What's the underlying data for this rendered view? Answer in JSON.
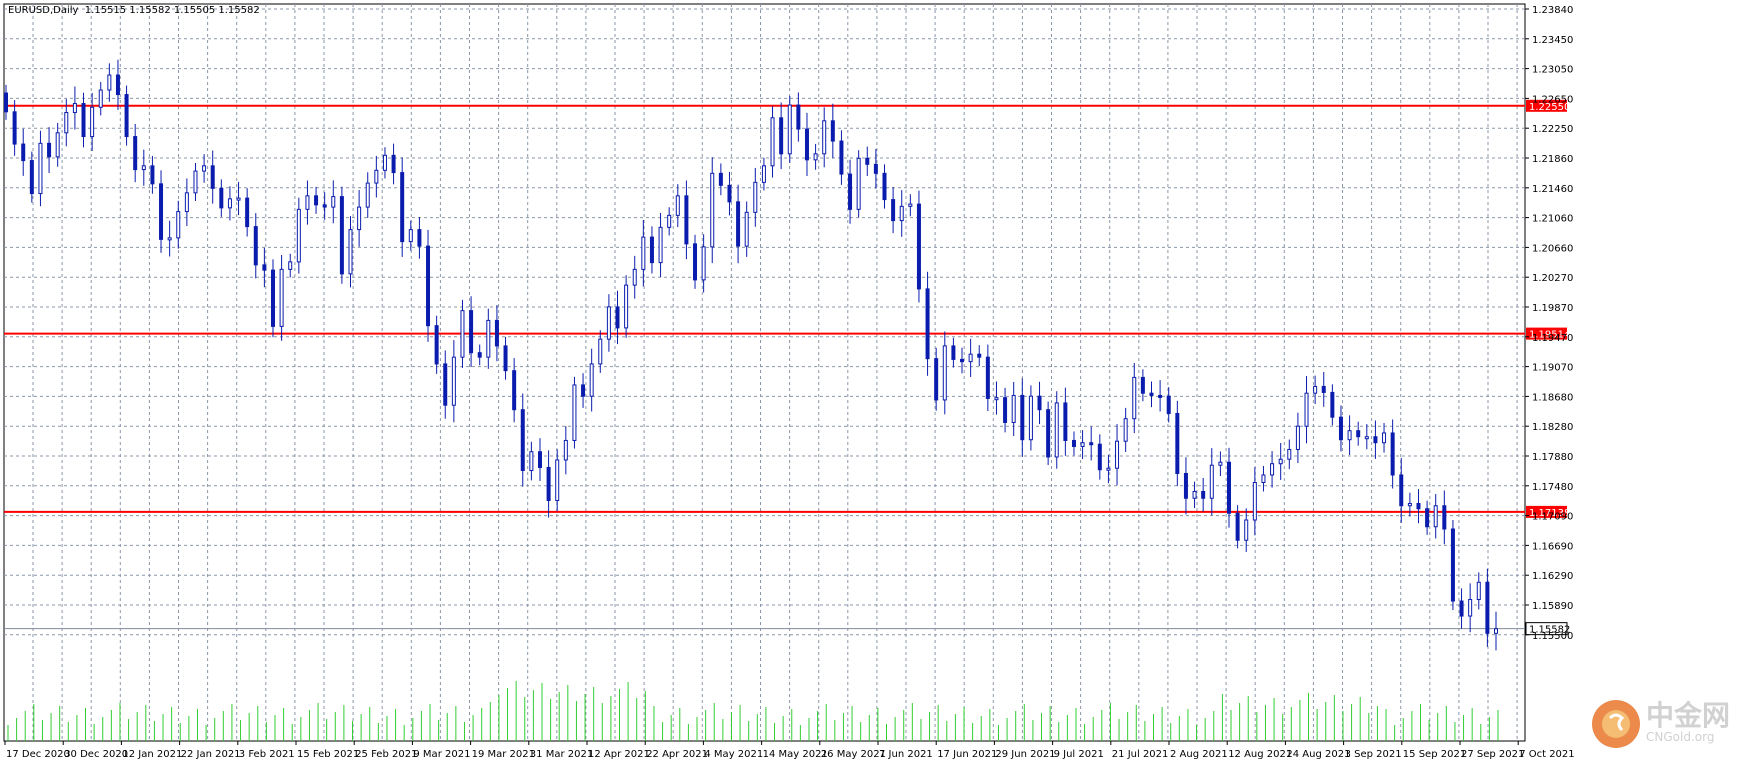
{
  "header": {
    "symbol": "EURUSD,Daily",
    "ohlc": "1.15515 1.15582 1.15505 1.15582"
  },
  "colors": {
    "candle": "#0a1cad",
    "grid": "#8a97a8",
    "level_line": "#ff0000",
    "volume": "#32cd32",
    "current_price_line": "#0a1cad"
  },
  "chart_data": {
    "type": "candlestick",
    "symbol": "EURUSD",
    "timeframe": "Daily",
    "y_ticks": [
      "1.23840",
      "1.23450",
      "1.23050",
      "1.22650",
      "1.22250",
      "1.21860",
      "1.21460",
      "1.21060",
      "1.20660",
      "1.20270",
      "1.19870",
      "1.19470",
      "1.19070",
      "1.18680",
      "1.18280",
      "1.17880",
      "1.17480",
      "1.17090",
      "1.16690",
      "1.16290",
      "1.15890",
      "1.15500"
    ],
    "x_ticks": [
      "17 Dec 2020",
      "30 Dec 2020",
      "12 Jan 2021",
      "22 Jan 2021",
      "3 Feb 2021",
      "15 Feb 2021",
      "25 Feb 2021",
      "9 Mar 2021",
      "19 Mar 2021",
      "31 Mar 2021",
      "12 Apr 2021",
      "22 Apr 2021",
      "4 May 2021",
      "14 May 2021",
      "26 May 2021",
      "7 Jun 2021",
      "17 Jun 2021",
      "29 Jun 2021",
      "9 Jul 2021",
      "21 Jul 2021",
      "2 Aug 2021",
      "12 Aug 2021",
      "24 Aug 2021",
      "3 Sep 2021",
      "15 Sep 2021",
      "27 Sep 2021",
      "7 Oct 2021"
    ],
    "horizontal_levels": [
      "1.22550",
      "1.19514",
      "1.17138"
    ],
    "current_price": "1.15582",
    "ylim": [
      1.155,
      1.2384
    ],
    "closes": [
      1.2247,
      1.2204,
      1.2182,
      1.2138,
      1.2205,
      1.2187,
      1.2219,
      1.2246,
      1.2258,
      1.2214,
      1.2253,
      1.2276,
      1.2296,
      1.227,
      1.2214,
      1.217,
      1.2175,
      1.2151,
      1.2077,
      1.2079,
      1.2114,
      1.2139,
      1.2168,
      1.2175,
      1.2145,
      1.2119,
      1.2131,
      1.2132,
      1.2094,
      1.2043,
      1.2036,
      1.1961,
      1.2037,
      1.2047,
      1.2117,
      1.2135,
      1.2123,
      1.212,
      1.2134,
      1.2031,
      1.209,
      1.212,
      1.2152,
      1.2169,
      1.2189,
      1.2166,
      1.2074,
      1.209,
      1.2068,
      1.1962,
      1.1911,
      1.1856,
      1.192,
      1.1982,
      1.1926,
      1.192,
      1.1969,
      1.1935,
      1.1902,
      1.185,
      1.1769,
      1.1794,
      1.1773,
      1.1729,
      1.1783,
      1.1809,
      1.1883,
      1.1868,
      1.1911,
      1.1944,
      1.1987,
      1.1959,
      1.2016,
      1.2037,
      1.208,
      1.2046,
      1.2093,
      1.2109,
      1.2135,
      1.2071,
      1.2023,
      1.2067,
      1.2165,
      1.2149,
      1.2127,
      1.2068,
      1.2113,
      1.2153,
      1.2175,
      1.2239,
      1.2191,
      1.2256,
      1.2224,
      1.2183,
      1.2191,
      1.2235,
      1.2208,
      1.2164,
      1.2117,
      1.2185,
      1.2177,
      1.2165,
      1.213,
      1.2102,
      1.2121,
      1.2124,
      1.2011,
      1.1918,
      1.1863,
      1.1935,
      1.1917,
      1.1914,
      1.1924,
      1.192,
      1.1865,
      1.1866,
      1.1833,
      1.1869,
      1.181,
      1.1868,
      1.185,
      1.1787,
      1.1859,
      1.1809,
      1.1801,
      1.1806,
      1.1804,
      1.177,
      1.1772,
      1.1808,
      1.1838,
      1.1893,
      1.1872,
      1.1869,
      1.1868,
      1.1845,
      1.1765,
      1.1732,
      1.1741,
      1.1732,
      1.1776,
      1.178,
      1.1712,
      1.1676,
      1.1703,
      1.1753,
      1.1763,
      1.1778,
      1.1784,
      1.1797,
      1.1828,
      1.1872,
      1.1881,
      1.1873,
      1.184,
      1.181,
      1.1822,
      1.1814,
      1.1814,
      1.1806,
      1.1819,
      1.1763,
      1.1722,
      1.1725,
      1.1718,
      1.1694,
      1.1722,
      1.1691,
      1.1595,
      1.1575,
      1.1597,
      1.162,
      1.1552,
      1.1558
    ]
  },
  "watermark": {
    "text": "中金网",
    "sub": "CNGold.org"
  }
}
